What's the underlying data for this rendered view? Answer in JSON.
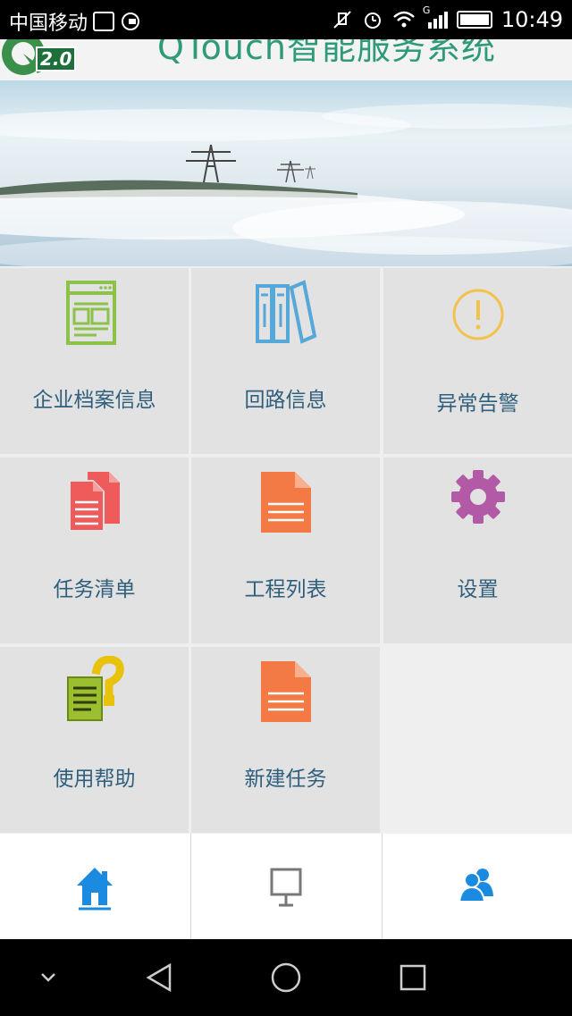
{
  "status_bar": {
    "carrier": "中国移动",
    "time": "10:49",
    "network_label": "G"
  },
  "header": {
    "title": "QTouch智能服务系统",
    "logo_version": "2.0"
  },
  "menu": [
    {
      "label": "企业档案信息",
      "icon": "document-window-icon",
      "color": "#8cc24a"
    },
    {
      "label": "回路信息",
      "icon": "binders-icon",
      "color": "#55a8d8"
    },
    {
      "label": "异常告警",
      "icon": "alert-circle-icon",
      "color": "#f2c24a"
    },
    {
      "label": "任务清单",
      "icon": "documents-stack-icon",
      "color": "#ef5a5a"
    },
    {
      "label": "工程列表",
      "icon": "document-icon",
      "color": "#f47a45"
    },
    {
      "label": "设置",
      "icon": "gear-icon",
      "color": "#b25aa5"
    },
    {
      "label": "使用帮助",
      "icon": "help-document-icon",
      "color": "#e8c20d"
    },
    {
      "label": "新建任务",
      "icon": "document-icon",
      "color": "#f47a45"
    }
  ],
  "bottom_nav": [
    {
      "icon": "home-icon",
      "active": true
    },
    {
      "icon": "presentation-board-icon",
      "active": false
    },
    {
      "icon": "users-icon",
      "active": false
    }
  ],
  "colors": {
    "accent": "#1a8be0",
    "tile_bg": "#e2e2e2",
    "label": "#2f5f7d",
    "title": "#2e9a7a"
  }
}
